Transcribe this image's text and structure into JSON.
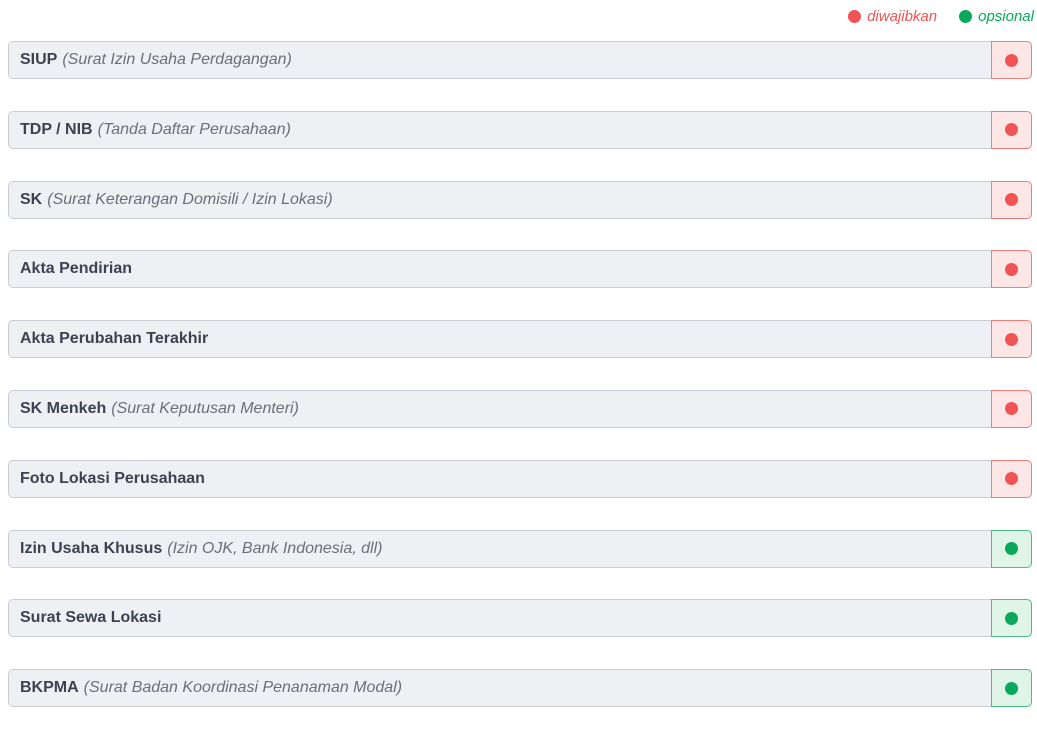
{
  "legend": {
    "required_label": "diwajibkan",
    "optional_label": "opsional",
    "required_color": "#f05454",
    "optional_color": "#0aa85a"
  },
  "documents": [
    {
      "name": "SIUP",
      "description": "(Surat Izin Usaha Perdagangan)",
      "status": "required"
    },
    {
      "name": "TDP / NIB",
      "description": "(Tanda Daftar Perusahaan)",
      "status": "required"
    },
    {
      "name": "SK",
      "description": "(Surat Keterangan Domisili / Izin Lokasi)",
      "status": "required"
    },
    {
      "name": "Akta Pendirian",
      "description": "",
      "status": "required"
    },
    {
      "name": "Akta Perubahan Terakhir",
      "description": "",
      "status": "required"
    },
    {
      "name": "SK Menkeh",
      "description": "(Surat Keputusan Menteri)",
      "status": "required"
    },
    {
      "name": "Foto Lokasi Perusahaan",
      "description": "",
      "status": "required"
    },
    {
      "name": "Izin Usaha Khusus",
      "description": "(Izin OJK, Bank Indonesia, dll)",
      "status": "optional"
    },
    {
      "name": "Surat Sewa Lokasi",
      "description": "",
      "status": "optional"
    },
    {
      "name": "BKPMA",
      "description": "(Surat Badan Koordinasi Penanaman Modal)",
      "status": "optional"
    }
  ]
}
